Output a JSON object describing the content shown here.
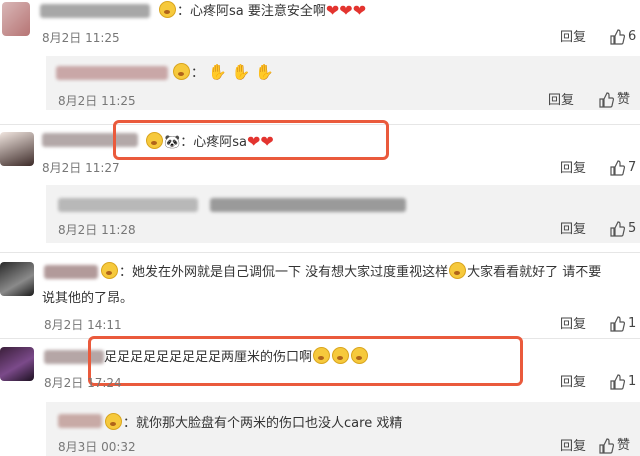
{
  "comments": [
    {
      "text": "：心疼阿sa 要注意安全啊",
      "hearts": "❤❤❤",
      "time": "8月2日 11:25",
      "reply": "回复",
      "like_count": "6"
    },
    {
      "time": "8月2日 11:25",
      "reply": "回复",
      "like": "赞"
    },
    {
      "text": "心疼阿sa",
      "hearts": "❤❤",
      "time": "8月2日 11:27",
      "reply": "回复",
      "like_count": "7"
    },
    {
      "time": "8月2日 11:28",
      "reply": "回复",
      "like_count": "5"
    },
    {
      "line1": "她发在外网就是自己调侃一下 没有想大家过度重视这样",
      "line1b": "大家看看就好了 请不要",
      "line2": "说其他的了昂。",
      "time": "8月2日 14:11",
      "reply": "回复",
      "like_count": "1"
    },
    {
      "text": "足足足足足足足足足两厘米的伤口啊",
      "time": "8月2日 17:24",
      "reply": "回复",
      "like_count": "1"
    },
    {
      "text": "就你那大脸盘有个两米的伤口也没人care 戏精",
      "time": "8月3日 00:32",
      "reply": "回复",
      "like": "赞"
    }
  ],
  "colors": {
    "highlight": "#ea5a3c",
    "reply_bg": "#f2f2f2",
    "heart": "#e3342f"
  }
}
